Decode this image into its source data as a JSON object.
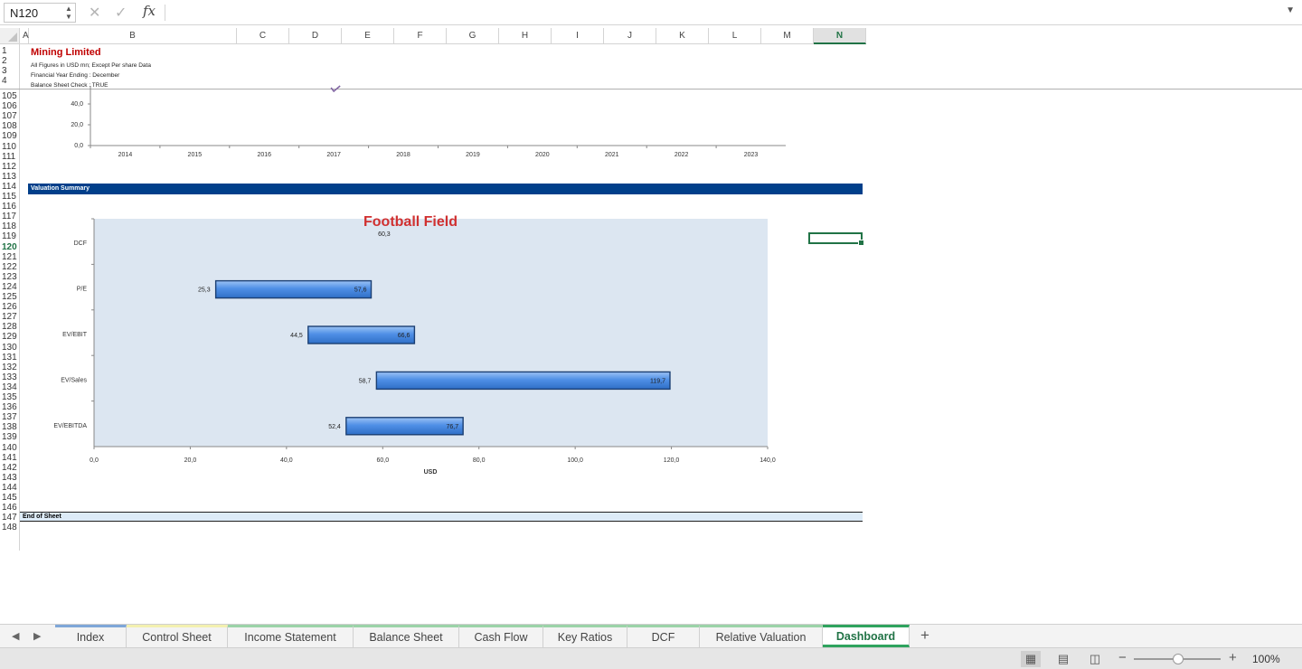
{
  "formula_bar": {
    "cell_ref": "N120",
    "formula": "",
    "cancel_glyph": "✕",
    "enter_glyph": "✓",
    "fx_label": "fx"
  },
  "columns": [
    "A",
    "B",
    "C",
    "D",
    "E",
    "F",
    "G",
    "H",
    "I",
    "J",
    "K",
    "L",
    "M",
    "N"
  ],
  "selected_column": "N",
  "rows": [
    "1",
    "2",
    "3",
    "4",
    "105",
    "106",
    "107",
    "108",
    "109",
    "110",
    "111",
    "112",
    "113",
    "114",
    "115",
    "116",
    "117",
    "118",
    "119",
    "120",
    "121",
    "122",
    "123",
    "124",
    "125",
    "126",
    "127",
    "128",
    "129",
    "130",
    "131",
    "132",
    "133",
    "134",
    "135",
    "136",
    "137",
    "138",
    "139",
    "140",
    "141",
    "142",
    "143",
    "144",
    "145",
    "146",
    "147",
    "148"
  ],
  "selected_row": "120",
  "sheet": {
    "title": "Mining Limited",
    "line2": "All Figures in USD mn; Except Per share Data",
    "line3": "Financial Year Ending : December",
    "line4": "Balance Sheet Check : TRUE",
    "section_band": "Valuation Summary",
    "end_band": "End of Sheet"
  },
  "chart_data": [
    {
      "type": "line",
      "title": "",
      "x": [
        "2014",
        "2015",
        "2016",
        "2017",
        "2018",
        "2019",
        "2020",
        "2021",
        "2022",
        "2023"
      ],
      "y_ticks": [
        "0,0",
        "20,0",
        "40,0"
      ],
      "ylim": [
        0,
        60
      ],
      "note": "partially scrolled out of view; only lower axis portion visible",
      "line_color": "#8064a2"
    },
    {
      "type": "bar",
      "orientation": "horizontal-floating",
      "title": "Football Field",
      "xlabel": "USD",
      "ylabel": "",
      "xlim": [
        0,
        140
      ],
      "x_ticks": [
        "0,0",
        "20,0",
        "40,0",
        "60,0",
        "80,0",
        "100,0",
        "120,0",
        "140,0"
      ],
      "categories": [
        "DCF",
        "P/E",
        "EV/EBIT",
        "EV/Sales",
        "EV/EBITDA"
      ],
      "bars": [
        {
          "category": "DCF",
          "low": 60.3,
          "high": 60.3,
          "low_label": "",
          "high_label": "60,3"
        },
        {
          "category": "P/E",
          "low": 25.3,
          "high": 57.6,
          "low_label": "25,3",
          "high_label": "57,6"
        },
        {
          "category": "EV/EBIT",
          "low": 44.5,
          "high": 66.6,
          "low_label": "44,5",
          "high_label": "66,6"
        },
        {
          "category": "EV/Sales",
          "low": 58.7,
          "high": 119.7,
          "low_label": "58,7",
          "high_label": "119,7"
        },
        {
          "category": "EV/EBITDA",
          "low": 52.4,
          "high": 76.7,
          "low_label": "52,4",
          "high_label": "76,7"
        }
      ],
      "plot_bg": "#dce6f1",
      "bar_color": "#4f8fe6",
      "title_color": "#d03030"
    }
  ],
  "tabs": [
    {
      "label": "Index",
      "color": "#7fa7d8",
      "active": false
    },
    {
      "label": "Control Sheet",
      "color": "#f3f0b0",
      "active": false
    },
    {
      "label": "Income Statement",
      "color": "#9bd3a8",
      "active": false
    },
    {
      "label": "Balance Sheet",
      "color": "#9bd3a8",
      "active": false
    },
    {
      "label": "Cash Flow",
      "color": "#9bd3a8",
      "active": false
    },
    {
      "label": "Key Ratios",
      "color": "#9bd3a8",
      "active": false
    },
    {
      "label": "DCF",
      "color": "#9bd3a8",
      "active": false
    },
    {
      "label": "Relative Valuation",
      "color": "#9bd3a8",
      "active": false
    },
    {
      "label": "Dashboard",
      "color": "#2fa35e",
      "active": true
    }
  ],
  "nav": {
    "prev": "◀",
    "next": "▶",
    "add": "+"
  },
  "status": {
    "zoom": "100%",
    "zoom_minus": "−",
    "zoom_plus": "+"
  },
  "icons": {
    "normal_view": "grid-view-icon",
    "page_layout": "page-layout-icon",
    "page_break": "page-break-icon"
  },
  "colors": {
    "accent": "#217346",
    "band": "#003f8a",
    "title_red": "#c00000"
  }
}
